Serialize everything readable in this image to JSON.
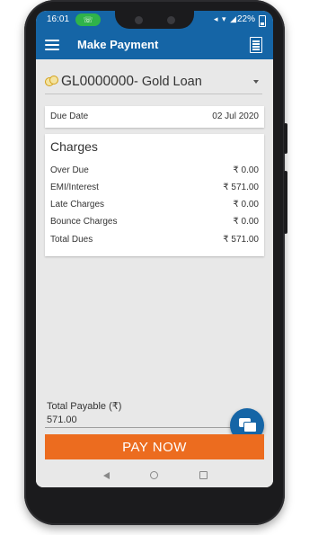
{
  "status_bar": {
    "time": "16:01",
    "call_indicator_icon": "phone-icon",
    "icons": "◂▾ ▾ ▐",
    "battery": "22%"
  },
  "app_bar": {
    "title": "Make Payment",
    "menu_icon": "hamburger-icon",
    "action_icon": "document-icon"
  },
  "loan_selector": {
    "loan_number": "GL0000000",
    "loan_type": "- Gold Loan"
  },
  "due_date": {
    "label": "Due Date",
    "value": "02 Jul 2020"
  },
  "charges": {
    "title": "Charges",
    "items": [
      {
        "label": "Over Due",
        "value": "₹ 0.00"
      },
      {
        "label": "EMI/Interest",
        "value": "₹ 571.00"
      },
      {
        "label": "Late Charges",
        "value": "₹ 0.00"
      },
      {
        "label": "Bounce Charges",
        "value": "₹ 0.00"
      },
      {
        "label": "Total Dues",
        "value": "₹ 571.00"
      }
    ]
  },
  "total_payable": {
    "label": "Total Payable (₹)",
    "value": "571.00"
  },
  "pay_button": {
    "label": "PAY NOW"
  },
  "colors": {
    "primary": "#1565a6",
    "accent": "#ec6c1f",
    "background": "#e8e8e8"
  }
}
